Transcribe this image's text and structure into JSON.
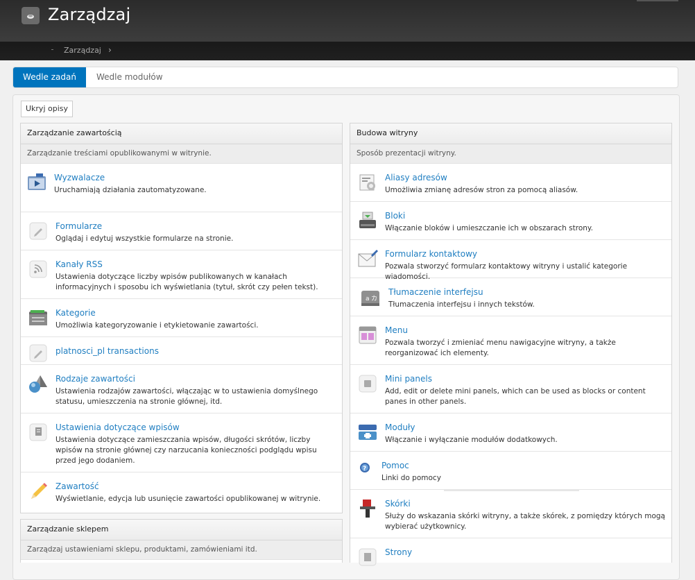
{
  "header": {
    "title": "Zarządzaj",
    "breadcrumb": "Zarządzaj",
    "breadcrumb_sep": "›"
  },
  "tabs": [
    {
      "label": "Wedle zadań",
      "active": true
    },
    {
      "label": "Wedle modułów",
      "active": false
    }
  ],
  "toolbar": {
    "hide_descriptions": "Ukryj opisy"
  },
  "colors": {
    "accent": "#0074bd",
    "link": "#1f7ec1",
    "header": "#2b2b2b"
  },
  "left_panel": {
    "title": "Zarządzanie zawartością",
    "description": "Zarządzanie treściami opublikowanymi w witrynie.",
    "items": [
      {
        "title": "Wyzwalacze",
        "desc": "Uruchamiają działania zautomatyzowane.",
        "icon": "trigger-icon"
      },
      {
        "title": "Formularze",
        "desc": "Oglądaj i edytuj wszystkie formularze na stronie.",
        "icon": "pencil-icon"
      },
      {
        "title": "Kanały RSS",
        "desc": "Ustawienia dotyczące liczby wpisów publikowanych w kanałach informacyjnych i sposobu ich wyświetlania (tytuł, skrót czy pełen tekst).",
        "icon": "rss-icon"
      },
      {
        "title": "Kategorie",
        "desc": "Umożliwia kategoryzowanie i etykietowanie zawartości.",
        "icon": "folder-icon"
      },
      {
        "title": "platnosci_pl transactions",
        "desc": "",
        "icon": "pencil-icon"
      },
      {
        "title": "Rodzaje zawartości",
        "desc": "Ustawienia rodzajów zawartości, włączając w to ustawienia domyślnego statusu, umieszczenia na stronie głównej, itd.",
        "icon": "shapes-icon"
      },
      {
        "title": "Ustawienia dotyczące wpisów",
        "desc": "Ustawienia dotyczące zamieszczania wpisów, długości skrótów, liczby wpisów na stronie głównej czy narzucania konieczności podglądu wpisu przed jego dodaniem.",
        "icon": "document-icon"
      },
      {
        "title": "Zawartość",
        "desc": "Wyświetlanie, edycja lub usunięcie zawartości opublikowanej w witrynie.",
        "icon": "pencil-color-icon"
      }
    ]
  },
  "left_panel_2": {
    "title": "Zarządzanie sklepem",
    "description": "Zarządzaj ustawieniami sklepu, produktami, zamówieniami itd."
  },
  "right_panel": {
    "title": "Budowa witryny",
    "description": "Sposób prezentacji witryny.",
    "items": [
      {
        "title": "Aliasy adresów",
        "desc": "Umożliwia zmianę adresów stron za pomocą aliasów.",
        "icon": "alias-icon"
      },
      {
        "title": "Bloki",
        "desc": "Włączanie bloków i umieszczanie ich w obszarach strony.",
        "icon": "blocks-icon"
      },
      {
        "title": "Formularz kontaktowy",
        "desc": "Pozwala stworzyć formularz kontaktowy witryny i ustalić kategorie wiadomości.",
        "icon": "envelope-icon"
      },
      {
        "title": "Tłumaczenie interfejsu",
        "desc": "Tłumaczenia interfejsu i innych tekstów.",
        "icon": "translate-icon"
      },
      {
        "title": "Menu",
        "desc": "Pozwala tworzyć i zmieniać menu nawigacyjne witryny, a także reorganizować ich elementy.",
        "icon": "menu-icon"
      },
      {
        "title": "Mini panels",
        "desc": "Add, edit or delete mini panels, which can be used as blocks or content panes in other panels.",
        "icon": "panel-icon"
      },
      {
        "title": "Moduły",
        "desc": "Włączanie i wyłączanie modułów dodatkowych.",
        "icon": "modules-icon"
      },
      {
        "title": "Pomoc",
        "desc": "Linki do pomocy",
        "icon": "help-icon"
      },
      {
        "title": "Skórki",
        "desc": "Służy do wskazania skórki witryny, a także skórek, z pomiędzy których mogą wybierać użytkownicy.",
        "icon": "brush-icon"
      },
      {
        "title": "Strony",
        "desc": "",
        "icon": "pages-icon"
      }
    ]
  }
}
